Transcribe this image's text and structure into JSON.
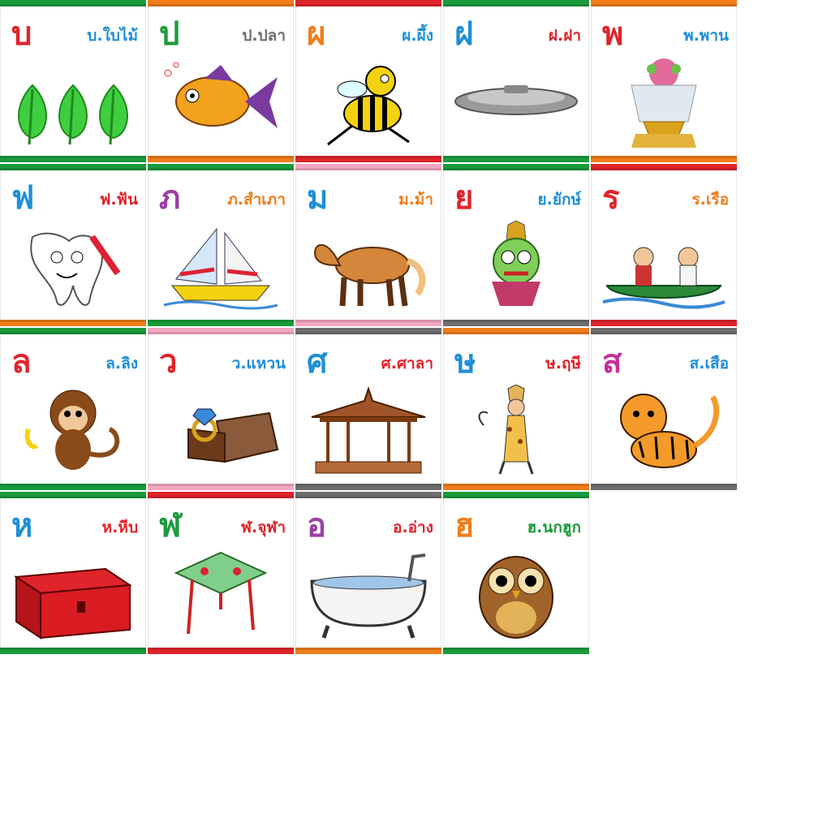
{
  "cards": [
    {
      "letter": "บ",
      "word": "บ.ใบไม้",
      "letter_color": "#e0242b",
      "word_color": "#1f8fd6",
      "top_color": "#1a9b3c",
      "bottom_color": "#1a9b3c",
      "icon": "leaves-icon"
    },
    {
      "letter": "ป",
      "word": "ป.ปลา",
      "letter_color": "#1a9b3c",
      "word_color": "#6d6d6d",
      "top_color": "#f07d1a",
      "bottom_color": "#f07d1a",
      "icon": "fish-icon"
    },
    {
      "letter": "ผ",
      "word": "ผ.ผึ้ง",
      "letter_color": "#f07d1a",
      "word_color": "#1f8fd6",
      "top_color": "#e0242b",
      "bottom_color": "#e0242b",
      "icon": "bee-icon"
    },
    {
      "letter": "ฝ",
      "word": "ฝ.ฝา",
      "letter_color": "#1f8fd6",
      "word_color": "#e0242b",
      "top_color": "#1a9b3c",
      "bottom_color": "#1a9b3c",
      "icon": "lid-icon"
    },
    {
      "letter": "พ",
      "word": "พ.พาน",
      "letter_color": "#e0242b",
      "word_color": "#1f8fd6",
      "top_color": "#f07d1a",
      "bottom_color": "#f07d1a",
      "icon": "offering-tray-icon"
    },
    {
      "letter": "ฟ",
      "word": "ฟ.ฟัน",
      "letter_color": "#1f8fd6",
      "word_color": "#e0242b",
      "top_color": "#1a9b3c",
      "bottom_color": "#f07d1a",
      "icon": "tooth-icon"
    },
    {
      "letter": "ภ",
      "word": "ภ.สำเภา",
      "letter_color": "#9b3fa3",
      "word_color": "#f07d1a",
      "top_color": "#1a9b3c",
      "bottom_color": "#1a9b3c",
      "icon": "sailboat-icon"
    },
    {
      "letter": "ม",
      "word": "ม.ม้า",
      "letter_color": "#1f8fd6",
      "word_color": "#f07d1a",
      "top_color": "#f4a7c0",
      "bottom_color": "#f4a7c0",
      "icon": "horse-icon"
    },
    {
      "letter": "ย",
      "word": "ย.ยักษ์",
      "letter_color": "#e0242b",
      "word_color": "#1f8fd6",
      "top_color": "#1a9b3c",
      "bottom_color": "#6d6d6d",
      "icon": "giant-icon"
    },
    {
      "letter": "ร",
      "word": "ร.เรือ",
      "letter_color": "#e0242b",
      "word_color": "#f07d1a",
      "top_color": "#e0242b",
      "bottom_color": "#e0242b",
      "icon": "canoe-icon"
    },
    {
      "letter": "ล",
      "word": "ล.ลิง",
      "letter_color": "#e0242b",
      "word_color": "#1f8fd6",
      "top_color": "#1a9b3c",
      "bottom_color": "#1a9b3c",
      "icon": "monkey-icon"
    },
    {
      "letter": "ว",
      "word": "ว.แหวน",
      "letter_color": "#e0242b",
      "word_color": "#1f8fd6",
      "top_color": "#f4a7c0",
      "bottom_color": "#f4a7c0",
      "icon": "ring-icon"
    },
    {
      "letter": "ศ",
      "word": "ศ.ศาลา",
      "letter_color": "#1f8fd6",
      "word_color": "#e0242b",
      "top_color": "#6d6d6d",
      "bottom_color": "#6d6d6d",
      "icon": "pavilion-icon"
    },
    {
      "letter": "ษ",
      "word": "ษ.ฤษี",
      "letter_color": "#1f8fd6",
      "word_color": "#e0242b",
      "top_color": "#f07d1a",
      "bottom_color": "#f07d1a",
      "icon": "hermit-icon"
    },
    {
      "letter": "ส",
      "word": "ส.เสือ",
      "letter_color": "#c52e9b",
      "word_color": "#1f8fd6",
      "top_color": "#6d6d6d",
      "bottom_color": "#6d6d6d",
      "icon": "tiger-icon"
    },
    {
      "letter": "ห",
      "word": "ห.หีบ",
      "letter_color": "#1f8fd6",
      "word_color": "#e0242b",
      "top_color": "#1a9b3c",
      "bottom_color": "#1a9b3c",
      "icon": "chest-icon"
    },
    {
      "letter": "ฬ",
      "word": "ฬ.จุฬา",
      "letter_color": "#1a9b3c",
      "word_color": "#e0242b",
      "top_color": "#e0242b",
      "bottom_color": "#e0242b",
      "icon": "kite-icon"
    },
    {
      "letter": "อ",
      "word": "อ.อ่าง",
      "letter_color": "#9b3fa3",
      "word_color": "#e0242b",
      "top_color": "#6d6d6d",
      "bottom_color": "#f07d1a",
      "icon": "bathtub-icon"
    },
    {
      "letter": "ฮ",
      "word": "ฮ.นกฮูก",
      "letter_color": "#f07d1a",
      "word_color": "#1a9b3c",
      "top_color": "#1a9b3c",
      "bottom_color": "#1a9b3c",
      "icon": "owl-icon"
    }
  ]
}
